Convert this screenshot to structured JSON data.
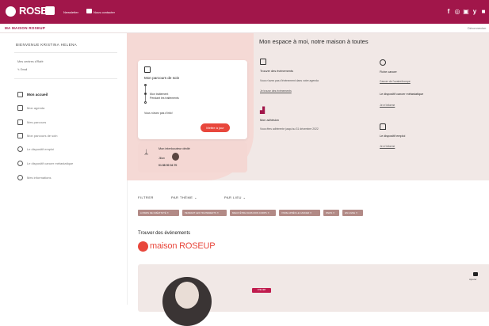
{
  "topbar": {
    "brand": "ROSE",
    "nav": [
      "Newsletter",
      "Nous contacter"
    ],
    "social": [
      "f",
      "◎",
      "▣",
      "y",
      "■"
    ]
  },
  "breadcrumb": {
    "title": "MA MAISON ROSEUP",
    "right_label": "Déconnexion"
  },
  "sidebar": {
    "welcome": "BIENVENUE KRISTINA HELENA",
    "account_line": "Mes centres d'Rafé",
    "email_line": "✎ Email",
    "menu": [
      {
        "label": "Mon accueil",
        "icon": "home-icon",
        "active": true
      },
      {
        "label": "Mon agenda",
        "icon": "calendar-icon",
        "active": false
      },
      {
        "label": "Mes parcours",
        "icon": "route-icon",
        "active": false
      },
      {
        "label": "Mon parcours de soin",
        "icon": "care-icon",
        "active": false
      },
      {
        "label": "Le dispositif emploi",
        "icon": "briefcase-icon",
        "active": false
      },
      {
        "label": "Le dispositif cancer métastatique",
        "icon": "ribbon-icon",
        "active": false
      },
      {
        "label": "Mes informations",
        "icon": "gear-icon",
        "active": false
      }
    ]
  },
  "hero": {
    "title": "Mon espace à moi, notre maison à toutes",
    "care_card": {
      "title": "Mon parcours de soin",
      "steps": [
        "Mon traitement",
        "Pendant les traitements"
      ],
      "note": "Vous n'avez pas d'info!",
      "cta": "Mettre à jour"
    },
    "contact_card": {
      "title": "Mon interlocuteur dédié",
      "name": "Jilian",
      "phone": "01 88 90 04 70"
    },
    "columns": [
      {
        "icon": "calendar-icon",
        "title": "Trouver des événements",
        "text": "Vous n'avez pas d'événement dans votre agenda",
        "link": "Je trouve des événements"
      },
      {
        "icon": "ribbon-icon",
        "title": "Fiche cancer",
        "text": "Cancer de l'ovaire/trompe",
        "link": ""
      },
      {
        "icon": "document-icon",
        "title": "Mon adhésion",
        "text": "Vous êtes adhérente jusqu'au 31 décembre 2022",
        "link": ""
      },
      {
        "icon": "info-icon",
        "title": "Le dispositif cancer métastatique",
        "text": "",
        "link": "Je m'informe"
      },
      {
        "icon": "briefcase-icon",
        "title": "Le dispositif emploi",
        "text": "",
        "link": "Je m'informe"
      }
    ]
  },
  "filters": {
    "label": "FILTRER",
    "by_theme": "PAR THÈME",
    "by_place": "PAR LIEU",
    "chips": [
      "LOISIRS DE CRÉATIVITÉ ✕",
      "PENDANT LES TRAITEMENTS ✕",
      "MIEUX ÊTRE DANS MON CORPS ✕",
      "VIVRE APRÈS LE CANCER ✕",
      "PARIS ✕",
      "EN LIGNE ✕"
    ]
  },
  "events": {
    "section_title": "Trouver des événements",
    "brand": "maison ROSEUP",
    "type_tag": "ATELIER",
    "save_label": "Ajouter"
  },
  "colors": {
    "brand": "#a1164a",
    "accent": "#e8473c",
    "hero_bg": "#f1e8e6",
    "chip": "#b28a86"
  }
}
